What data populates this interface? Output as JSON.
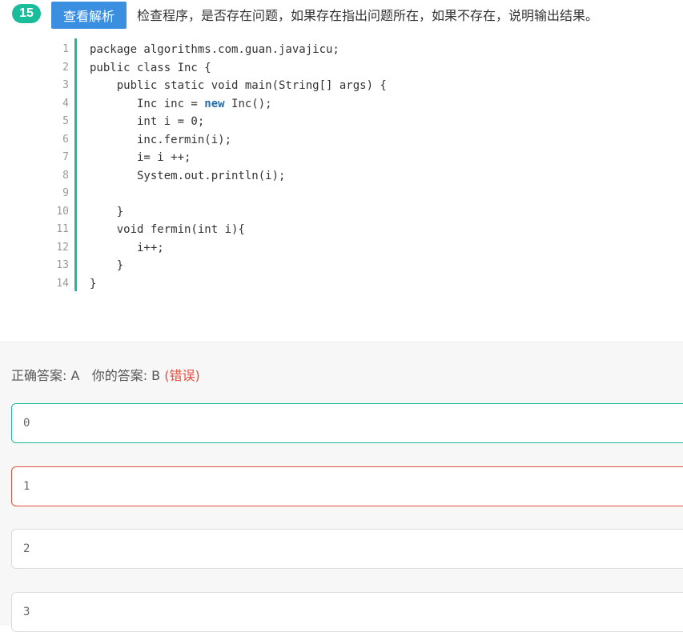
{
  "question": {
    "number": "15",
    "analysis_button": "查看解析",
    "text": "检查程序，是否存在问题，如果存在指出问题所在，如果不存在，说明输出结果。"
  },
  "code": {
    "lines": [
      {
        "n": "1",
        "pre": "package algorithms.com.guan.javajicu;",
        "kw": "",
        "post": ""
      },
      {
        "n": "2",
        "pre": "public class Inc {",
        "kw": "",
        "post": ""
      },
      {
        "n": "3",
        "pre": "    public static void main(String[] args) {",
        "kw": "",
        "post": ""
      },
      {
        "n": "4",
        "pre": "       Inc inc = ",
        "kw": "new",
        "post": " Inc();"
      },
      {
        "n": "5",
        "pre": "       int i = 0;",
        "kw": "",
        "post": ""
      },
      {
        "n": "6",
        "pre": "       inc.fermin(i);",
        "kw": "",
        "post": ""
      },
      {
        "n": "7",
        "pre": "       i= i ++;",
        "kw": "",
        "post": ""
      },
      {
        "n": "8",
        "pre": "       System.out.println(i);",
        "kw": "",
        "post": ""
      },
      {
        "n": "9",
        "pre": "",
        "kw": "",
        "post": ""
      },
      {
        "n": "10",
        "pre": "    }",
        "kw": "",
        "post": ""
      },
      {
        "n": "11",
        "pre": "    void fermin(int i){",
        "kw": "",
        "post": ""
      },
      {
        "n": "12",
        "pre": "       i++;",
        "kw": "",
        "post": ""
      },
      {
        "n": "13",
        "pre": "    }",
        "kw": "",
        "post": ""
      },
      {
        "n": "14",
        "pre": "}",
        "kw": "",
        "post": ""
      }
    ]
  },
  "answer": {
    "correct_label": "正确答案: A",
    "your_label": "你的答案: B",
    "status": "(错误)"
  },
  "options": [
    {
      "value": "0",
      "state": "correct"
    },
    {
      "value": "1",
      "state": "incorrect"
    },
    {
      "value": "2",
      "state": "normal"
    },
    {
      "value": "3",
      "state": "normal"
    }
  ],
  "colors": {
    "accent": "#1abc9c",
    "button": "#3b8fe0",
    "error": "#e74c3c"
  }
}
